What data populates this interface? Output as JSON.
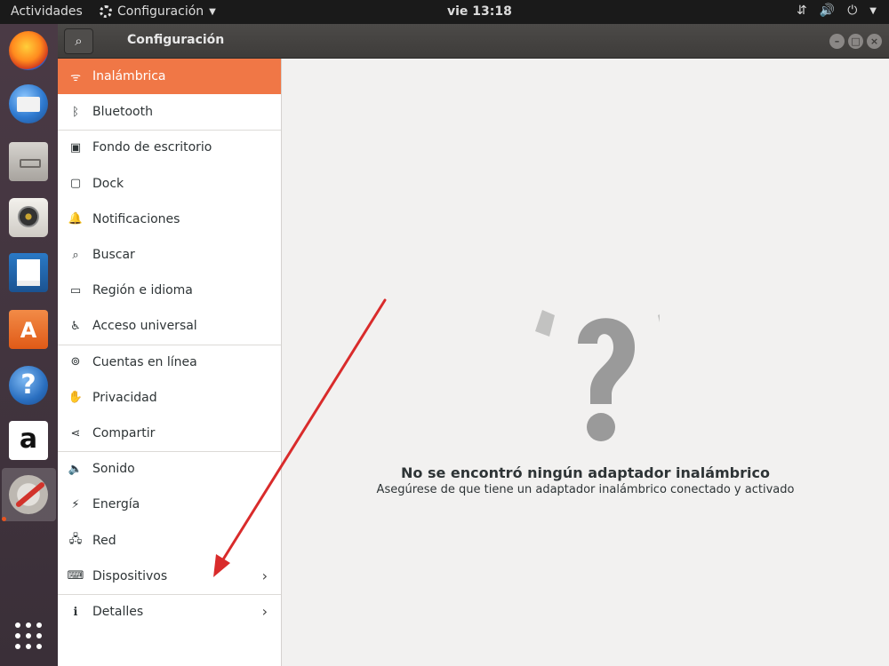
{
  "topbar": {
    "activities": "Actividades",
    "app_menu": "Configuración",
    "clock": "vie 13:18",
    "tray_icons": [
      "network-icon",
      "volume-icon",
      "power-icon"
    ]
  },
  "dock": {
    "items": [
      "firefox-icon",
      "thunderbird-icon",
      "files-icon",
      "rhythmbox-icon",
      "writer-icon",
      "software-icon",
      "help-icon",
      "amazon-icon",
      "settings-icon"
    ],
    "store_glyph": "A",
    "help_glyph": "?",
    "amazon_glyph": "a"
  },
  "window": {
    "title": "Configuración",
    "search_glyph": "⌕",
    "controls": [
      "minimize",
      "maximize",
      "close"
    ]
  },
  "sidebar": {
    "items": [
      {
        "label": "Inalámbrica",
        "icon": "wifi-icon",
        "glyph": "ᯤ",
        "selected": true
      },
      {
        "label": "Bluetooth",
        "icon": "bluetooth-icon",
        "glyph": "ᛒ"
      },
      {
        "label": "Fondo de escritorio",
        "icon": "background-icon",
        "glyph": "▣"
      },
      {
        "label": "Dock",
        "icon": "dock-icon",
        "glyph": "▢"
      },
      {
        "label": "Notificaciones",
        "icon": "bell-icon",
        "glyph": "🔔"
      },
      {
        "label": "Buscar",
        "icon": "search-icon",
        "glyph": "⌕"
      },
      {
        "label": "Región e idioma",
        "icon": "region-icon",
        "glyph": "▭"
      },
      {
        "label": "Acceso universal",
        "icon": "accessibility-icon",
        "glyph": "♿"
      },
      {
        "label": "Cuentas en línea",
        "icon": "online-accounts-icon",
        "glyph": "⊚"
      },
      {
        "label": "Privacidad",
        "icon": "privacy-icon",
        "glyph": "✋"
      },
      {
        "label": "Compartir",
        "icon": "share-icon",
        "glyph": "⋖"
      },
      {
        "label": "Sonido",
        "icon": "sound-icon",
        "glyph": "🔈"
      },
      {
        "label": "Energía",
        "icon": "power-icon",
        "glyph": "⚡"
      },
      {
        "label": "Red",
        "icon": "network-icon",
        "glyph": "🖧"
      },
      {
        "label": "Dispositivos",
        "icon": "devices-icon",
        "glyph": "⌨",
        "chevron": "›"
      },
      {
        "label": "Detalles",
        "icon": "info-icon",
        "glyph": "ℹ",
        "chevron": "›"
      }
    ]
  },
  "empty_state": {
    "icon": "question-mark-icon",
    "title": "No se encontró ningún adaptador inalámbrico",
    "subtitle": "Asegúrese de que tiene un adaptador inalámbrico conectado y activado"
  },
  "colors": {
    "accent": "#f07746",
    "arrow": "#d92b2b",
    "icon_gray": "#9a9a9a"
  }
}
